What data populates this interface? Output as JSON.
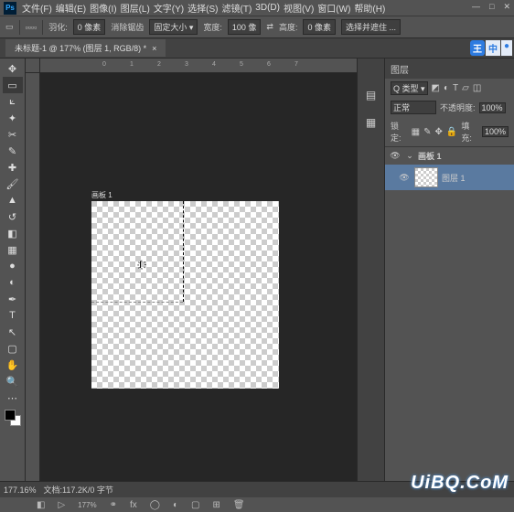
{
  "menu": {
    "items": [
      "文件(F)",
      "编辑(E)",
      "图像(I)",
      "图层(L)",
      "文字(Y)",
      "选择(S)",
      "滤镜(T)",
      "3D(D)",
      "视图(V)",
      "窗口(W)",
      "帮助(H)"
    ],
    "logo": "Ps"
  },
  "winctrl": {
    "min": "—",
    "max": "□",
    "close": "✕"
  },
  "options": {
    "marquee_icon": "▭",
    "feather_label": "羽化:",
    "feather_value": "0 像素",
    "antialias": "消除锯齿",
    "style_label": "固定大小 ▾",
    "width_label": "宽度:",
    "width_value": "100 像",
    "swap": "⇄",
    "height_label": "高度:",
    "height_value": "0 像素",
    "mask_btn": "选择并遮住 ..."
  },
  "tab": {
    "title": "未标题-1 @ 177% (图层 1, RGB/8) *",
    "close": "×"
  },
  "ruler_ticks": [
    "0",
    "1",
    "2",
    "3",
    "4",
    "5",
    "6",
    "7"
  ],
  "artboard_label": "画板 1",
  "panels": {
    "tab": "图层",
    "kind_label": "Q 类型 ▾",
    "blend": "正常",
    "opacity_label": "不透明度:",
    "opacity": "100%",
    "lock_label": "锁定:",
    "fill_label": "填充:",
    "fill": "100%",
    "layers": [
      {
        "name": "画板 1",
        "expanded": true
      },
      {
        "name": "图层 1",
        "selected": true
      }
    ]
  },
  "ime": {
    "a": "王",
    "b": "中",
    "c": "●"
  },
  "status": {
    "zoom": "177.16%",
    "info": "文档:117.2K/0 字节"
  },
  "watermark": "UiBQ.CoM",
  "bottom": {
    "zoom_label": "177%"
  }
}
